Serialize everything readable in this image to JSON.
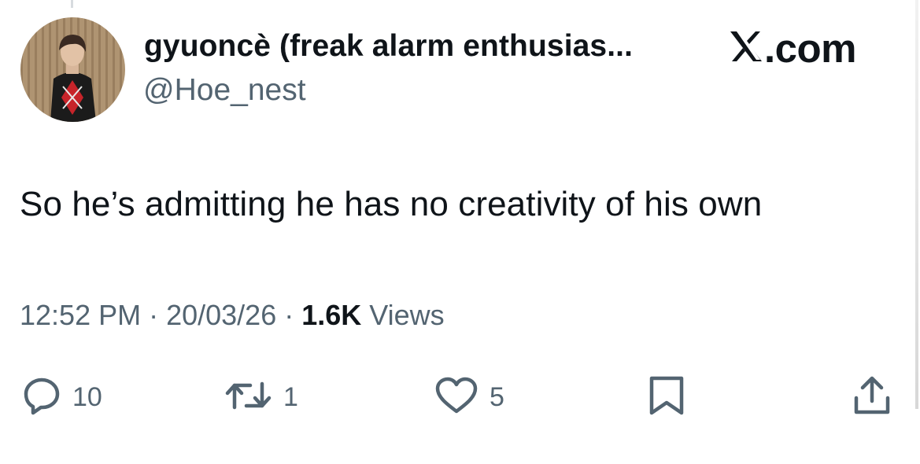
{
  "author": {
    "display_name": "gyuoncè (freak alarm enthusias...",
    "handle": "@Hoe_nest"
  },
  "brand": {
    "logo_icon": "x-logo-icon",
    "text": ".com"
  },
  "tweet": {
    "text": "So he’s admitting he has no creativity of his own"
  },
  "meta": {
    "time": "12:52 PM",
    "separator_1": " · ",
    "date": "20/03/26",
    "separator_2": " · ",
    "views_count": "1.6K",
    "views_label": " Views"
  },
  "actions": {
    "reply": {
      "icon": "reply-icon",
      "count": "10"
    },
    "retweet": {
      "icon": "retweet-icon",
      "count": "1"
    },
    "like": {
      "icon": "heart-icon",
      "count": "5"
    },
    "bookmark": {
      "icon": "bookmark-icon"
    },
    "share": {
      "icon": "share-icon"
    }
  },
  "colors": {
    "text_primary": "#0f1419",
    "text_secondary": "#536471",
    "background": "#ffffff"
  }
}
